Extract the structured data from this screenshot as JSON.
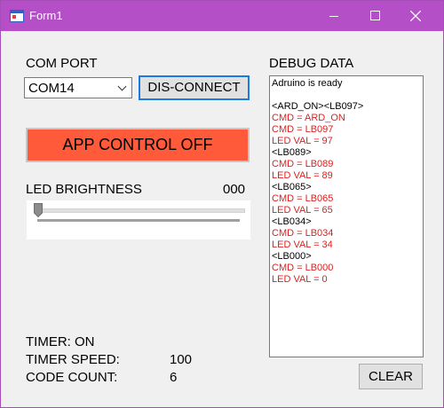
{
  "window": {
    "title": "Form1"
  },
  "com_port": {
    "label": "COM PORT",
    "selected": "COM14",
    "connect_button": "DIS-CONNECT"
  },
  "app_control": {
    "label": "APP CONTROL OFF",
    "color": "#ff5a3a"
  },
  "brightness": {
    "label": "LED BRIGHTNESS",
    "value": "000",
    "slider_level": 0
  },
  "status": {
    "timer_label": "TIMER: ON",
    "timer_speed_label": "TIMER SPEED:",
    "timer_speed_value": "100",
    "code_count_label": "CODE COUNT:",
    "code_count_value": "6"
  },
  "debug": {
    "label": "DEBUG DATA",
    "clear_button": "CLEAR",
    "lines": [
      {
        "text": "Adruino is ready",
        "color": "#000000"
      },
      {
        "text": "",
        "color": "#000000"
      },
      {
        "text": "<ARD_ON><LB097>",
        "color": "#000000"
      },
      {
        "text": "CMD = ARD_ON",
        "color": "#e01e1e"
      },
      {
        "text": "CMD = LB097",
        "color": "#e01e1e"
      },
      {
        "text": "LED VAL = 97",
        "color": "#e01e1e"
      },
      {
        "text": "<LB089>",
        "color": "#000000"
      },
      {
        "text": "CMD = LB089",
        "color": "#e01e1e"
      },
      {
        "text": "LED VAL = 89",
        "color": "#e01e1e"
      },
      {
        "text": "<LB065>",
        "color": "#000000"
      },
      {
        "text": "CMD = LB065",
        "color": "#e01e1e"
      },
      {
        "text": "LED VAL = 65",
        "color": "#e01e1e"
      },
      {
        "text": "<LB034>",
        "color": "#000000"
      },
      {
        "text": "CMD = LB034",
        "color": "#e01e1e"
      },
      {
        "text": "LED VAL = 34",
        "color": "#e01e1e"
      },
      {
        "text": "<LB000>",
        "color": "#000000"
      },
      {
        "text": "CMD = LB000",
        "color": "#e01e1e"
      },
      {
        "text": "LED VAL = 0",
        "color": "#e01e1e"
      }
    ]
  },
  "colors": {
    "titlebar": "#b54fc8",
    "accent_focus": "#1a7be0"
  }
}
